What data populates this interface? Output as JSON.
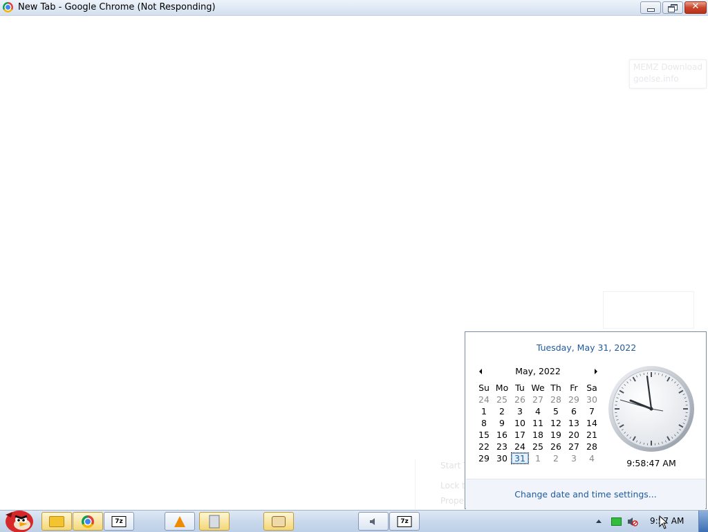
{
  "window": {
    "title": "New Tab - Google Chrome (Not Responding)",
    "close_label": "✕"
  },
  "ghost_notice": {
    "line1": "MEMZ Download",
    "line2": "goelse.info"
  },
  "ghost_menu": {
    "line1": "Start T",
    "line2": "Lock t",
    "line3": "Prope"
  },
  "calendar": {
    "long_date": "Tuesday, May 31, 2022",
    "month_title": "May, 2022",
    "weekdays": [
      "Su",
      "Mo",
      "Tu",
      "We",
      "Th",
      "Fr",
      "Sa"
    ],
    "weeks": [
      [
        "24",
        "25",
        "26",
        "27",
        "28",
        "29",
        "30"
      ],
      [
        "1",
        "2",
        "3",
        "4",
        "5",
        "6",
        "7"
      ],
      [
        "8",
        "9",
        "10",
        "11",
        "12",
        "13",
        "14"
      ],
      [
        "15",
        "16",
        "17",
        "18",
        "19",
        "20",
        "21"
      ],
      [
        "22",
        "23",
        "24",
        "25",
        "26",
        "27",
        "28"
      ],
      [
        "29",
        "30",
        "31",
        "1",
        "2",
        "3",
        "4"
      ]
    ],
    "today": "31",
    "clock_time": "9:58:47 AM",
    "settings_link": "Change date and time settings..."
  },
  "taskbar": {
    "clock": "9:57 AM",
    "seven_zip_label": "7z",
    "buttons": [
      {
        "name": "folder",
        "icon": "folder-icon"
      },
      {
        "name": "chrome",
        "icon": "chrome-icon"
      },
      {
        "name": "7zip",
        "icon": "7zip-icon"
      },
      {
        "name": "vlc",
        "icon": "vlc-icon"
      },
      {
        "name": "calculator",
        "icon": "calculator-icon"
      },
      {
        "name": "paint",
        "icon": "paint-icon"
      },
      {
        "name": "volume",
        "icon": "speaker-icon"
      },
      {
        "name": "7zip-2",
        "icon": "7zip-icon"
      }
    ]
  },
  "colors": {
    "link_blue": "#1e5a9e",
    "taskbar_top": "#dfe9f5"
  }
}
